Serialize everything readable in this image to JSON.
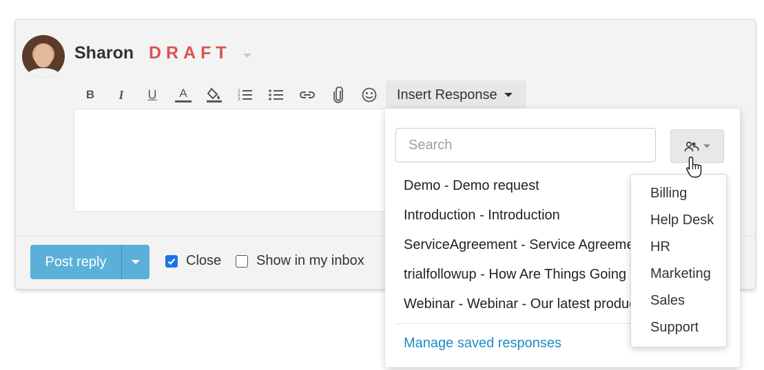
{
  "reply": {
    "author": "Sharon",
    "status": "DRAFT"
  },
  "toolbar": {
    "bold": "B",
    "italic": "I",
    "underline": "U",
    "text_color": "A",
    "insert_response_label": "Insert Response"
  },
  "insert_response": {
    "search_placeholder": "Search",
    "responses": [
      "Demo - Demo request",
      "Introduction - Introduction",
      "ServiceAgreement - Service Agreement",
      "trialfollowup - How Are Things Going",
      "Webinar - Webinar - Our latest product"
    ],
    "manage_link": "Manage saved responses",
    "groups": [
      "Billing",
      "Help Desk",
      "HR",
      "Marketing",
      "Sales",
      "Support"
    ]
  },
  "footer": {
    "post_reply_label": "Post reply",
    "close_label": "Close",
    "close_checked": true,
    "show_in_inbox_label": "Show in my inbox",
    "show_in_inbox_checked": false
  },
  "colors": {
    "draft": "#d9534f",
    "primary_button": "#5bb0d8",
    "link": "#1f8ac6",
    "checkbox_checked": "#1a73e8"
  }
}
